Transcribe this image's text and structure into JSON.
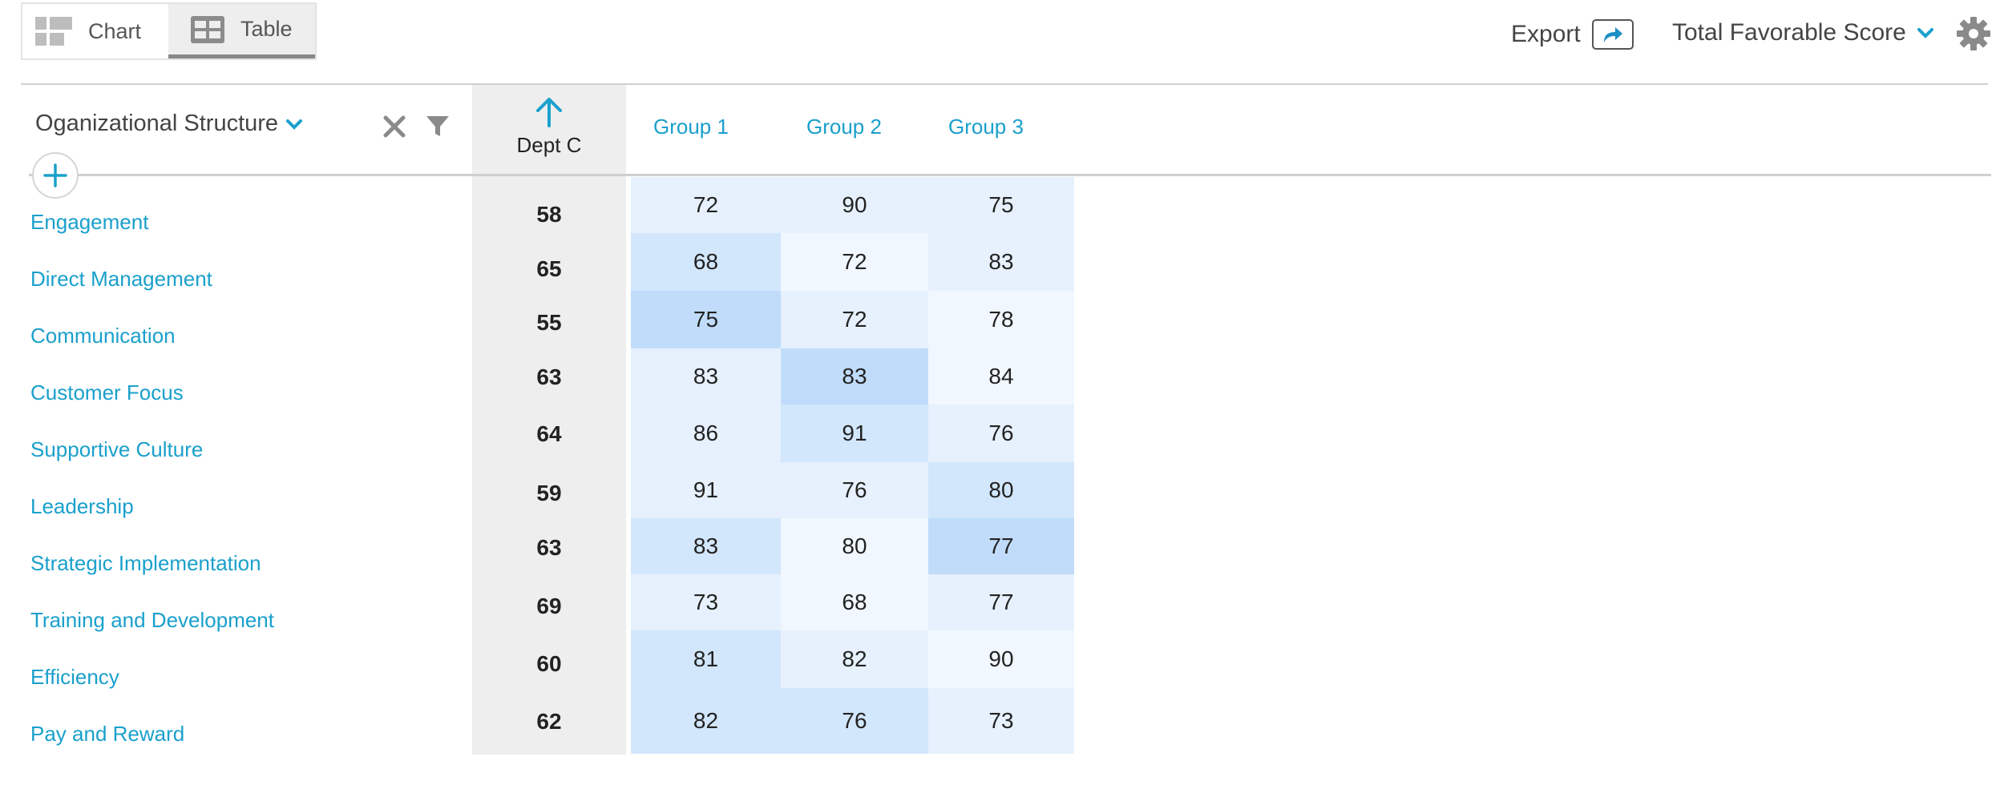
{
  "toggle": {
    "chart_label": "Chart",
    "table_label": "Table",
    "active": "Table"
  },
  "toolbar": {
    "export_label": "Export",
    "score_label": "Total Favorable Score"
  },
  "colors": {
    "accent": "#1aa0cc",
    "heat_light": "#f1f7fe",
    "heat_mid": "#e6f1fd",
    "heat_strong": "#d2e6fc",
    "heat_max": "#c0dcfa",
    "dept_bg": "#eeeeee"
  },
  "filter_header": {
    "title": "Oganizational Structure"
  },
  "columns": {
    "dept_c": "Dept C",
    "groups": [
      "Group 1",
      "Group 2",
      "Group 3"
    ]
  },
  "rows": [
    {
      "label": "Engagement",
      "dept_c": "58",
      "g1": "72",
      "g2": "90",
      "g3": "75"
    },
    {
      "label": "Direct Management",
      "dept_c": "65",
      "g1": "68",
      "g2": "72",
      "g3": "83"
    },
    {
      "label": "Communication",
      "dept_c": "55",
      "g1": "75",
      "g2": "72",
      "g3": "78"
    },
    {
      "label": "Customer Focus",
      "dept_c": "63",
      "g1": "83",
      "g2": "83",
      "g3": "84"
    },
    {
      "label": "Supportive Culture",
      "dept_c": "64",
      "g1": "86",
      "g2": "91",
      "g3": "76"
    },
    {
      "label": "Leadership",
      "dept_c": "59",
      "g1": "91",
      "g2": "76",
      "g3": "80"
    },
    {
      "label": "Strategic Implementation",
      "dept_c": "63",
      "g1": "83",
      "g2": "80",
      "g3": "77"
    },
    {
      "label": "Training and Development",
      "dept_c": "69",
      "g1": "73",
      "g2": "68",
      "g3": "77"
    },
    {
      "label": "Efficiency",
      "dept_c": "60",
      "g1": "81",
      "g2": "82",
      "g3": "90"
    },
    {
      "label": "Pay and Reward",
      "dept_c": "62",
      "g1": "82",
      "g2": "76",
      "g3": "73"
    }
  ]
}
